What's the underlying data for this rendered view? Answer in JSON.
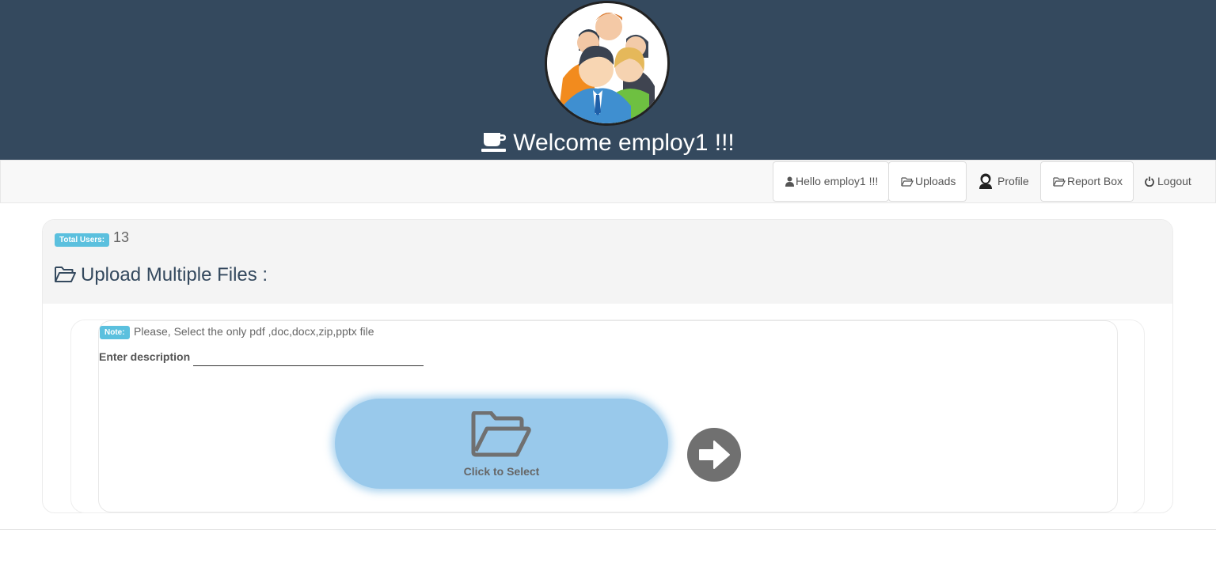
{
  "header": {
    "welcome_text": "Welcome employ1 !!!"
  },
  "nav": {
    "hello": "Hello employ1 !!!",
    "uploads": "Uploads",
    "profile": "Profile",
    "report_box": "Report Box",
    "logout": "Logout"
  },
  "stats": {
    "total_users_label": "Total Users:",
    "total_users_value": "13"
  },
  "upload": {
    "title": "Upload Multiple Files :",
    "note_label": "Note:",
    "note_text": "Please, Select the only pdf ,doc,docx,zip,pptx file",
    "description_label": "Enter description",
    "description_value": "",
    "select_label": "Click to Select"
  },
  "colors": {
    "header_bg": "#34495e",
    "badge": "#5bc0de",
    "select_button": "#99c9eb",
    "arrow_button": "#707070"
  },
  "icons": {
    "welcome": "coffee-cup-icon",
    "hello": "user-icon",
    "uploads": "folder-open-icon",
    "profile": "profile-avatar-icon",
    "report_box": "folder-open-icon",
    "logout": "power-icon",
    "title": "folder-open-icon",
    "select": "folder-open-icon",
    "submit": "arrow-right-circle-icon"
  }
}
